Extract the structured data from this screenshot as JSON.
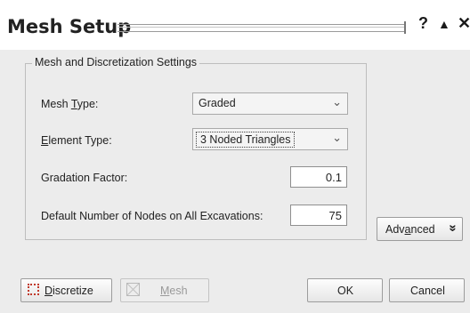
{
  "window": {
    "title": "Mesh Setup",
    "help_label": "?",
    "collapse_label": "▲",
    "close_label": "✕"
  },
  "group": {
    "title": "Mesh and Discretization Settings",
    "mesh_type": {
      "label_pre": "Mesh ",
      "label_key": "T",
      "label_post": "ype:",
      "value": "Graded"
    },
    "element_type": {
      "label_key": "E",
      "label_post": "lement Type:",
      "value": "3 Noded Triangles"
    },
    "gradation_factor": {
      "label": "Gradation Factor:",
      "value": "0.1"
    },
    "default_nodes": {
      "label": "Default Number of Nodes on All Excavations:",
      "value": "75"
    }
  },
  "buttons": {
    "advanced": {
      "pre": "Adv",
      "key": "a",
      "post": "nced",
      "chevron": "»"
    },
    "discretize": {
      "key": "D",
      "post": "iscretize"
    },
    "mesh": {
      "key": "M",
      "post": "esh"
    },
    "ok": "OK",
    "cancel": "Cancel"
  }
}
